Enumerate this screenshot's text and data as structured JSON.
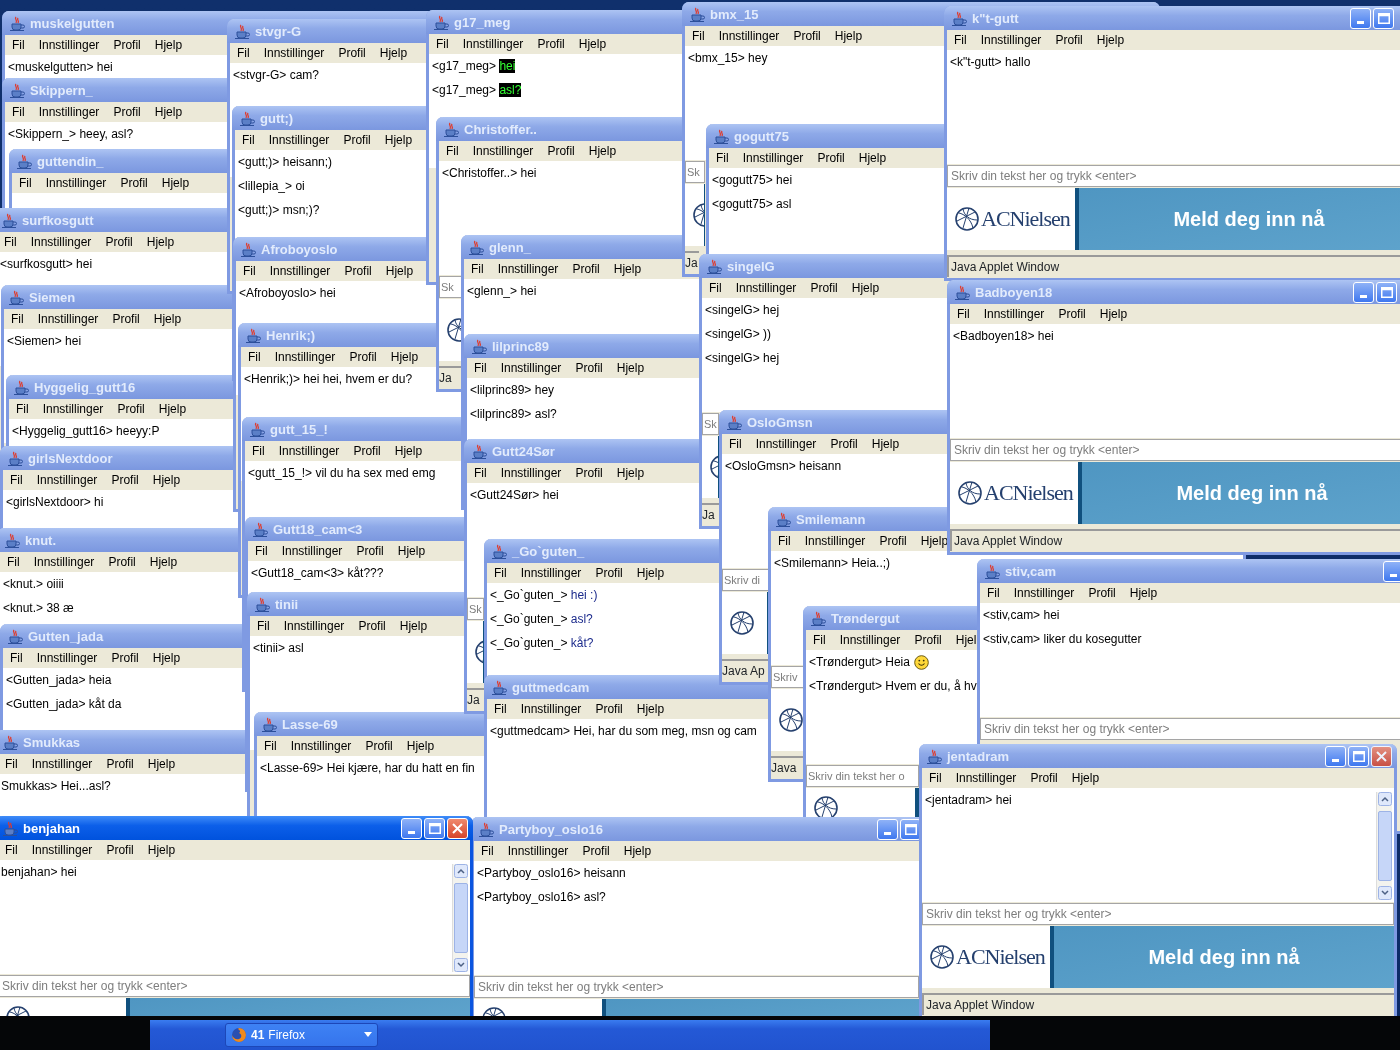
{
  "windows": [
    {
      "title": "muskelgutten",
      "active": false,
      "menu": [
        "Fil",
        "Innstillinger",
        "Profil",
        "Hjelp"
      ],
      "messages": [
        {
          "nick": "<muskelgutten>",
          "text": "hei",
          "kind": "plain"
        }
      ]
    },
    {
      "title": "Skippern_",
      "active": false,
      "menu": [
        "Fil",
        "Innstillinger",
        "Profil",
        "Hjelp"
      ],
      "messages": [
        {
          "nick": "<Skippern_>",
          "text": "heey, asl?",
          "kind": "plain"
        }
      ]
    },
    {
      "title": "guttendin_",
      "active": false,
      "menu": [
        "Fil",
        "Innstillinger",
        "Profil",
        "Hjelp"
      ]
    },
    {
      "title": "surfkosgutt",
      "active": false,
      "menu": [
        "Fil",
        "Innstillinger",
        "Profil",
        "Hjelp"
      ],
      "messages": [
        {
          "nick": "<surfkosgutt>",
          "text": "hei",
          "kind": "plain"
        }
      ]
    },
    {
      "title": "Siemen",
      "active": false,
      "menu": [
        "Fil",
        "Innstillinger",
        "Profil",
        "Hjelp"
      ],
      "messages": [
        {
          "nick": "<Siemen>",
          "text": "hei",
          "kind": "plain"
        }
      ]
    },
    {
      "title": "Hyggelig_gutt16",
      "active": false,
      "menu": [
        "Fil",
        "Innstillinger",
        "Profil",
        "Hjelp"
      ],
      "messages": [
        {
          "nick": "<Hyggelig_gutt16>",
          "text": "heeyy:P",
          "kind": "plain"
        }
      ]
    },
    {
      "title": "girlsNextdoor",
      "active": false,
      "menu": [
        "Fil",
        "Innstillinger",
        "Profil",
        "Hjelp"
      ],
      "messages": [
        {
          "nick": "<girlsNextdoor>",
          "text": "hi",
          "kind": "plain"
        }
      ]
    },
    {
      "title": "knut.",
      "active": false,
      "menu": [
        "Fil",
        "Innstillinger",
        "Profil",
        "Hjelp"
      ],
      "messages": [
        {
          "nick": "<knut.>",
          "text": "oiiii",
          "kind": "plain"
        },
        {
          "nick": "<knut.>",
          "text": "38 æ",
          "kind": "plain"
        }
      ]
    },
    {
      "title": "Gutten_jada",
      "active": false,
      "menu": [
        "Fil",
        "Innstillinger",
        "Profil",
        "Hjelp"
      ],
      "messages": [
        {
          "nick": "<Gutten_jada>",
          "text": "heia",
          "kind": "plain"
        },
        {
          "nick": "<Gutten_jada>",
          "text": "kåt da",
          "kind": "plain"
        }
      ]
    },
    {
      "title": "Smukkas",
      "active": false,
      "menu": [
        "Fil",
        "Innstillinger",
        "Profil",
        "Hjelp"
      ],
      "messages": [
        {
          "nick": "Smukkas>",
          "text": "Hei...asl?",
          "kind": "plain"
        }
      ]
    },
    {
      "title": "stvgr-G",
      "active": false,
      "menu": [
        "Fil",
        "Innstillinger",
        "Profil",
        "Hjelp"
      ],
      "messages": [
        {
          "nick": "<stvgr-G>",
          "text": "cam?",
          "kind": "plain"
        }
      ]
    },
    {
      "title": "gutt;)",
      "active": false,
      "menu": [
        "Fil",
        "Innstillinger",
        "Profil",
        "Hjelp"
      ],
      "messages": [
        {
          "nick": "<gutt;)>",
          "text": "heisann;)",
          "kind": "plain"
        },
        {
          "nick": "<lillepia_>",
          "text": "oi",
          "kind": "plain"
        },
        {
          "nick": "<gutt;)>",
          "text": "msn;)?",
          "kind": "plain"
        }
      ]
    },
    {
      "title": "Afroboyoslo",
      "active": false,
      "menu": [
        "Fil",
        "Innstillinger",
        "Profil",
        "Hjelp"
      ],
      "messages": [
        {
          "nick": "<Afroboyoslo>",
          "text": "hei",
          "kind": "plain"
        }
      ]
    },
    {
      "title": "Henrik;)",
      "active": false,
      "menu": [
        "Fil",
        "Innstillinger",
        "Profil",
        "Hjelp"
      ],
      "messages": [
        {
          "nick": "<Henrik;)>",
          "text": "hei hei, hvem er du?",
          "kind": "plain"
        }
      ]
    },
    {
      "title": "gutt_15_!",
      "active": false,
      "menu": [
        "Fil",
        "Innstillinger",
        "Profil",
        "Hjelp"
      ],
      "messages": [
        {
          "nick": "<gutt_15_!>",
          "text": "vil du ha sex med emg",
          "kind": "plain"
        }
      ]
    },
    {
      "title": "Gutt18_cam<3",
      "active": false,
      "menu": [
        "Fil",
        "Innstillinger",
        "Profil",
        "Hjelp"
      ],
      "messages": [
        {
          "nick": "<Gutt18_cam<3>",
          "text": "kåt???",
          "kind": "plain"
        }
      ]
    },
    {
      "title": "tinii",
      "active": false,
      "menu": [
        "Fil",
        "Innstillinger",
        "Profil",
        "Hjelp"
      ],
      "messages": [
        {
          "nick": "<tinii>",
          "text": "asl",
          "kind": "plain"
        }
      ]
    },
    {
      "title": "Lasse-69",
      "active": false,
      "menu": [
        "Fil",
        "Innstillinger",
        "Profil",
        "Hjelp"
      ],
      "messages": [
        {
          "nick": "<Lasse-69>",
          "text": "Hei kjære, har du hatt en fin",
          "kind": "plain"
        }
      ]
    },
    {
      "title": "g17_meg",
      "active": false,
      "menu": [
        "Fil",
        "Innstillinger",
        "Profil",
        "Hjelp"
      ],
      "messages": [
        {
          "nick": "<g17_meg>",
          "text": "hei",
          "kind": "highlight"
        },
        {
          "nick": "<g17_meg>",
          "text": "asl?",
          "kind": "highlight"
        }
      ]
    },
    {
      "title": "Christoffer..",
      "active": false,
      "menu": [
        "Fil",
        "Innstillinger",
        "Profil",
        "Hjelp"
      ],
      "messages": [
        {
          "nick": "<Christoffer..>",
          "text": "hei",
          "kind": "plain"
        }
      ],
      "input": {
        "placeholder": "Sk"
      },
      "ad_visible": true,
      "status": "Ja"
    },
    {
      "title": "glenn_",
      "active": false,
      "menu": [
        "Fil",
        "Innstillinger",
        "Profil",
        "Hjelp"
      ],
      "messages": [
        {
          "nick": "<glenn_>",
          "text": "hei",
          "kind": "plain"
        }
      ]
    },
    {
      "title": "lilprinc89",
      "active": false,
      "menu": [
        "Fil",
        "Innstillinger",
        "Profil",
        "Hjelp"
      ],
      "messages": [
        {
          "nick": "<lilprinc89>",
          "text": "hey",
          "kind": "plain"
        },
        {
          "nick": "<lilprinc89>",
          "text": "asl?",
          "kind": "plain"
        }
      ]
    },
    {
      "title": "Gutt24Sør",
      "active": false,
      "menu": [
        "Fil",
        "Innstillinger",
        "Profil",
        "Hjelp"
      ],
      "messages": [
        {
          "nick": "<Gutt24Sør>",
          "text": "hei",
          "kind": "plain"
        }
      ],
      "input": {
        "placeholder": "Sk"
      },
      "ad_visible": true,
      "status": "Ja"
    },
    {
      "title": "_Go`guten_",
      "active": false,
      "menu": [
        "Fil",
        "Innstillinger",
        "Profil",
        "Hjelp"
      ],
      "messages": [
        {
          "nick": "<_Go`guten_>",
          "text": "hei :)",
          "kind": "blue"
        },
        {
          "nick": "<_Go`guten_>",
          "text": "asl?",
          "kind": "blue"
        },
        {
          "nick": "<_Go`guten_>",
          "text": "kåt?",
          "kind": "blue"
        }
      ]
    },
    {
      "title": "guttmedcam",
      "active": false,
      "menu": [
        "Fil",
        "Innstillinger",
        "Profil",
        "Hjelp"
      ],
      "messages": [
        {
          "nick": "<guttmedcam>",
          "text": "Hei, har du som meg, msn og cam",
          "kind": "plain"
        }
      ]
    },
    {
      "title": "bmx_15",
      "active": false,
      "menu": [
        "Fil",
        "Innstillinger",
        "Profil",
        "Hjelp"
      ],
      "messages": [
        {
          "nick": "<bmx_15>",
          "text": "hey",
          "kind": "plain"
        }
      ],
      "input": {
        "placeholder": "Sk"
      },
      "ad_visible": true,
      "status": "Ja"
    },
    {
      "title": "gogutt75",
      "active": false,
      "menu": [
        "Fil",
        "Innstillinger",
        "Profil",
        "Hjelp"
      ],
      "messages": [
        {
          "nick": "<gogutt75>",
          "text": "hei",
          "kind": "plain"
        },
        {
          "nick": "<gogutt75>",
          "text": "asl",
          "kind": "plain"
        }
      ]
    },
    {
      "title": "singelG",
      "active": false,
      "menu": [
        "Fil",
        "Innstillinger",
        "Profil",
        "Hjelp"
      ],
      "messages": [
        {
          "nick": "<singelG>",
          "text": "hej",
          "kind": "plain"
        },
        {
          "nick": "<singelG>",
          "text": "))",
          "kind": "plain"
        },
        {
          "nick": "<singelG>",
          "text": "hej",
          "kind": "plain"
        }
      ],
      "input": {
        "placeholder": "Sk"
      },
      "ad_visible": true,
      "status": "Ja"
    },
    {
      "title": "OsloGmsn",
      "active": false,
      "menu": [
        "Fil",
        "Innstillinger",
        "Profil",
        "Hjelp"
      ],
      "messages": [
        {
          "nick": "<OsloGmsn>",
          "text": "heisann",
          "kind": "plain"
        }
      ],
      "input": {
        "placeholder": "Skriv di"
      },
      "ad_visible": true,
      "status": "Java Ap"
    },
    {
      "title": "Smilemann",
      "active": false,
      "menu": [
        "Fil",
        "Innstillinger",
        "Profil",
        "Hjelp"
      ],
      "messages": [
        {
          "nick": "<Smilemann>",
          "text": "Heia..;)",
          "kind": "plain"
        }
      ],
      "input": {
        "placeholder": "Skriv"
      },
      "ad_visible": true,
      "status": "Java"
    },
    {
      "title": "Trøndergut",
      "active": false,
      "menu": [
        "Fil",
        "Innstillinger",
        "Profil",
        "Hjel"
      ],
      "messages": [
        {
          "nick": "<Trøndergut>",
          "text": "Heia",
          "kind": "smiley"
        },
        {
          "nick": "<Trøndergut>",
          "text": "Hvem er du, å hv",
          "kind": "plain"
        }
      ],
      "input": {
        "placeholder": "Skriv din tekst her o"
      },
      "ad_visible": true
    },
    {
      "title": "k\"t-gutt",
      "active": false,
      "controls": [
        {
          "kind": "minimize"
        },
        {
          "kind": "maximize"
        }
      ],
      "menu": [
        "Fil",
        "Innstillinger",
        "Profil",
        "Hjelp"
      ],
      "messages": [
        {
          "nick": "<k\"t-gutt>",
          "text": "hallo",
          "kind": "plain"
        }
      ],
      "input": {
        "placeholder": "Skriv din tekst her og trykk <enter>"
      },
      "ad_visible": true,
      "banner": {
        "logo": "ACNielsen",
        "cta": "Meld deg inn nå"
      },
      "status": "Java Applet Window"
    },
    {
      "title": "Badboyen18",
      "active": false,
      "controls": [
        {
          "kind": "minimize"
        },
        {
          "kind": "maximize"
        }
      ],
      "menu": [
        "Fil",
        "Innstillinger",
        "Profil",
        "Hjelp"
      ],
      "messages": [
        {
          "nick": "<Badboyen18>",
          "text": "hei",
          "kind": "plain"
        }
      ],
      "input": {
        "placeholder": "Skriv din tekst her og trykk <enter>"
      },
      "ad_visible": true,
      "banner": {
        "logo": "ACNielsen",
        "cta": "Meld deg inn nå"
      },
      "status": "Java Applet Window"
    },
    {
      "title": "stiv,cam",
      "active": false,
      "controls": [
        {
          "kind": "minimize"
        }
      ],
      "menu": [
        "Fil",
        "Innstillinger",
        "Profil",
        "Hjelp"
      ],
      "messages": [
        {
          "nick": "<stiv,cam>",
          "text": "hei",
          "kind": "plain"
        },
        {
          "nick": "<stiv,cam>",
          "text": "liker du kosegutter",
          "kind": "plain"
        }
      ],
      "input": {
        "placeholder": "Skriv din tekst her og trykk <enter>"
      }
    },
    {
      "title": "Partyboy_oslo16",
      "active": false,
      "controls": [
        {
          "kind": "minimize"
        },
        {
          "kind": "maximize"
        }
      ],
      "menu": [
        "Fil",
        "Innstillinger",
        "Profil",
        "Hjelp"
      ],
      "messages": [
        {
          "nick": "<Partyboy_oslo16>",
          "text": "heisann",
          "kind": "plain"
        },
        {
          "nick": "<Partyboy_oslo16>",
          "text": "asl?",
          "kind": "plain"
        }
      ],
      "input": {
        "placeholder": "Skriv din tekst her og trykk <enter>"
      },
      "ad_visible": true
    },
    {
      "title": "jentadram",
      "active": false,
      "controls": [
        {
          "kind": "minimize"
        },
        {
          "kind": "maximize"
        },
        {
          "kind": "close"
        }
      ],
      "menu": [
        "Fil",
        "Innstillinger",
        "Profil",
        "Hjelp"
      ],
      "messages": [
        {
          "nick": "<jentadram>",
          "text": "hei",
          "kind": "plain"
        }
      ],
      "scrollbar": true,
      "input": {
        "placeholder": "Skriv din tekst her og trykk <enter>"
      },
      "ad_visible": true,
      "banner": {
        "logo": "ACNielsen",
        "cta": "Meld deg inn nå"
      },
      "status": "Java Applet Window"
    },
    {
      "title": "benjahan",
      "active": true,
      "controls": [
        {
          "kind": "minimize"
        },
        {
          "kind": "maximize"
        },
        {
          "kind": "close"
        }
      ],
      "menu": [
        "Fil",
        "Innstillinger",
        "Profil",
        "Hjelp"
      ],
      "messages": [
        {
          "nick": "benjahan>",
          "text": "hei",
          "kind": "plain"
        }
      ],
      "scrollbar": true,
      "input": {
        "placeholder": "Skriv din tekst her og trykk <enter>"
      },
      "ad_visible": true
    }
  ],
  "taskbar": {
    "buttons": [
      {
        "count": "41",
        "label": "Firefox"
      }
    ]
  }
}
